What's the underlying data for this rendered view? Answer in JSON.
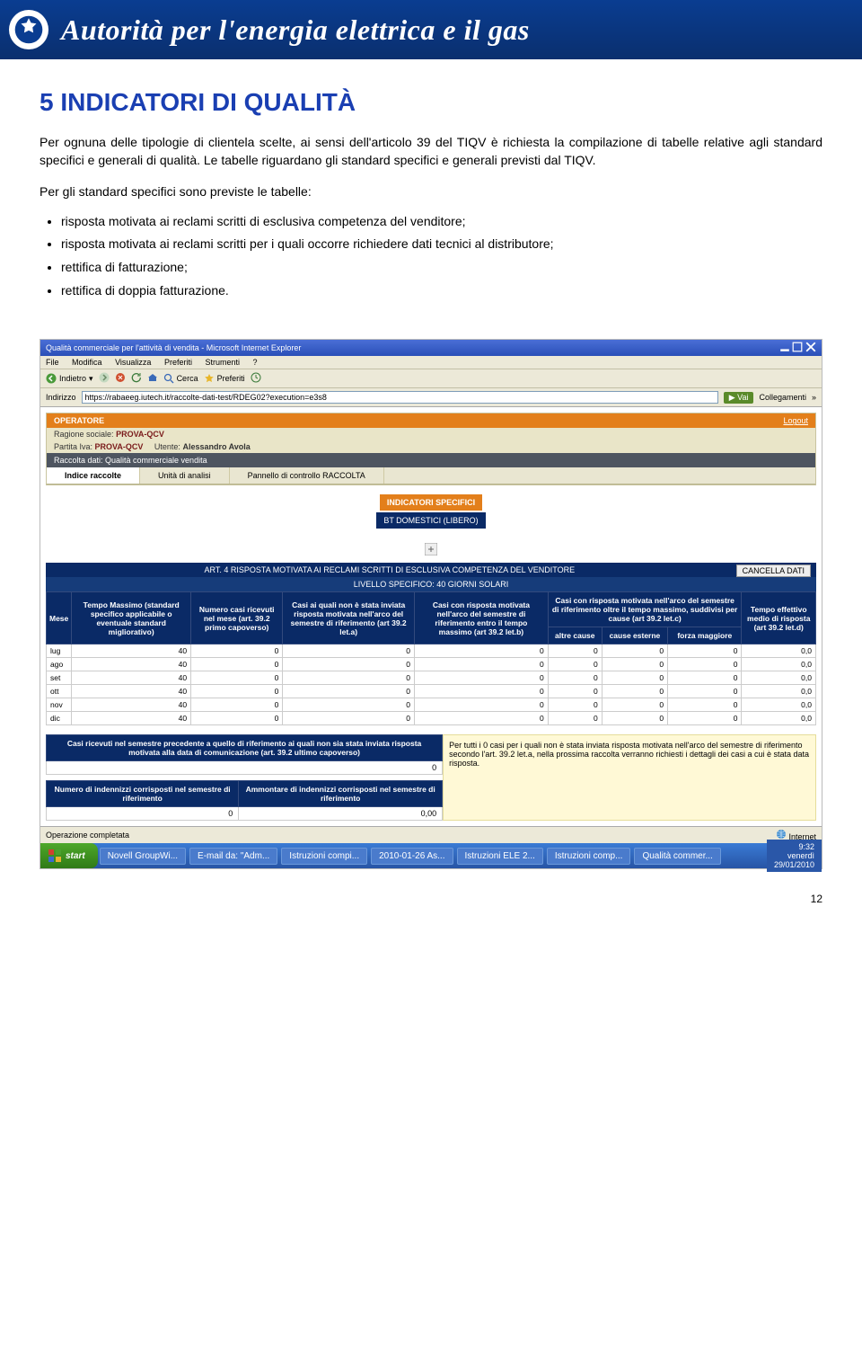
{
  "banner": {
    "title": "Autorità per l'energia elettrica e il gas"
  },
  "section": {
    "heading": "5 INDICATORI DI QUALITÀ"
  },
  "para1": "Per ognuna delle tipologie di clientela scelte, ai sensi dell'articolo 39 del TIQV è richiesta la compilazione di tabelle relative agli standard specifici e generali di qualità. Le tabelle riguardano gli standard specifici e generali previsti dal TIQV.",
  "para2": "Per gli standard specifici sono previste le tabelle:",
  "bullets": [
    "risposta motivata ai reclami scritti di esclusiva competenza del venditore;",
    "risposta motivata ai reclami scritti per i quali occorre richiedere dati tecnici al distributore;",
    "rettifica di fatturazione;",
    "rettifica di doppia fatturazione."
  ],
  "ie": {
    "title": "Qualità commerciale per l'attività di vendita - Microsoft Internet Explorer",
    "menus": [
      "File",
      "Modifica",
      "Visualizza",
      "Preferiti",
      "Strumenti",
      "?"
    ],
    "tools": {
      "back": "Indietro",
      "search": "Cerca",
      "fav": "Preferiti"
    },
    "addr_label": "Indirizzo",
    "url": "https://rabaeeg.iutech.it/raccolte-dati-test/RDEG02?execution=e3s8",
    "go": "Vai",
    "links": "Collegamenti"
  },
  "app": {
    "operatore": "OPERATORE",
    "logout": "Logout",
    "ragione": "Ragione sociale:",
    "ragione_v": "PROVA-QCV",
    "piva": "Partita Iva:",
    "piva_v": "PROVA-QCV",
    "utente": "Utente:",
    "utente_v": "Alessandro Avola",
    "raccolta": "Raccolta dati: Qualità commerciale vendita",
    "tab1": "Indice raccolte",
    "tab2": "Unità di analisi",
    "tab3": "Pannello di controllo RACCOLTA",
    "indic_title": "INDICATORI SPECIFICI",
    "indic_sub": "BT DOMESTICI (LIBERO)",
    "table_title": "ART. 4   RISPOSTA MOTIVATA AI RECLAMI SCRITTI DI ESCLUSIVA COMPETENZA DEL VENDITORE",
    "table_sub": "LIVELLO SPECIFICO: 40 GIORNI SOLARI",
    "cancella": "CANCELLA DATI"
  },
  "cols": {
    "mese": "Mese",
    "c1": "Tempo Massimo (standard specifico applicabile o eventuale standard migliorativo)",
    "c2": "Numero casi ricevuti nel mese (art. 39.2 primo capoverso)",
    "c3": "Casi ai quali non è stata inviata risposta motivata nell'arco del semestre di riferimento (art 39.2 let.a)",
    "c4": "Casi con risposta motivata nell'arco del semestre di riferimento entro il tempo massimo (art 39.2 let.b)",
    "cgroup": "Casi con risposta motivata nell'arco del semestre di riferimento oltre il tempo massimo, suddivisi per cause (art 39.2 let.c)",
    "c5": "altre cause",
    "c6": "cause esterne",
    "c7": "forza maggiore",
    "c8": "Tempo effettivo medio di risposta (art 39.2 let.d)"
  },
  "rows": [
    {
      "m": "lug",
      "v": [
        "40",
        "0",
        "0",
        "0",
        "0",
        "0",
        "0",
        "0,0"
      ]
    },
    {
      "m": "ago",
      "v": [
        "40",
        "0",
        "0",
        "0",
        "0",
        "0",
        "0",
        "0,0"
      ]
    },
    {
      "m": "set",
      "v": [
        "40",
        "0",
        "0",
        "0",
        "0",
        "0",
        "0",
        "0,0"
      ]
    },
    {
      "m": "ott",
      "v": [
        "40",
        "0",
        "0",
        "0",
        "0",
        "0",
        "0",
        "0,0"
      ]
    },
    {
      "m": "nov",
      "v": [
        "40",
        "0",
        "0",
        "0",
        "0",
        "0",
        "0",
        "0,0"
      ]
    },
    {
      "m": "dic",
      "v": [
        "40",
        "0",
        "0",
        "0",
        "0",
        "0",
        "0",
        "0,0"
      ]
    }
  ],
  "below": {
    "left_h": "Casi ricevuti nel semestre precedente a quello di riferimento ai quali non sia stata inviata risposta motivata alla data di comunicazione (art. 39.2 ultimo capoverso)",
    "left_v": "0",
    "right_text": "Per tutti i 0 casi per i quali non è stata inviata risposta motivata nell'arco del semestre di riferimento secondo l'art. 39.2 let.a, nella prossima raccolta verranno richiesti i dettagli dei casi a cui è stata data risposta.",
    "ind_h": "Numero di indennizzi corrisposti nel semestre di riferimento",
    "ind_v": "0",
    "amm_h": "Ammontare di indennizzi corrisposti nel semestre di riferimento",
    "amm_v": "0,00"
  },
  "status": {
    "done": "Operazione completata",
    "zone": "Internet"
  },
  "taskbar": {
    "start": "start",
    "items": [
      "Novell GroupWi...",
      "E-mail da: \"Adm...",
      "Istruzioni compi...",
      "2010-01-26 As...",
      "Istruzioni ELE 2...",
      "Istruzioni comp...",
      "Qualità commer..."
    ],
    "time": "9:32",
    "day": "venerdì",
    "date": "29/01/2010"
  },
  "pagenum": "12"
}
